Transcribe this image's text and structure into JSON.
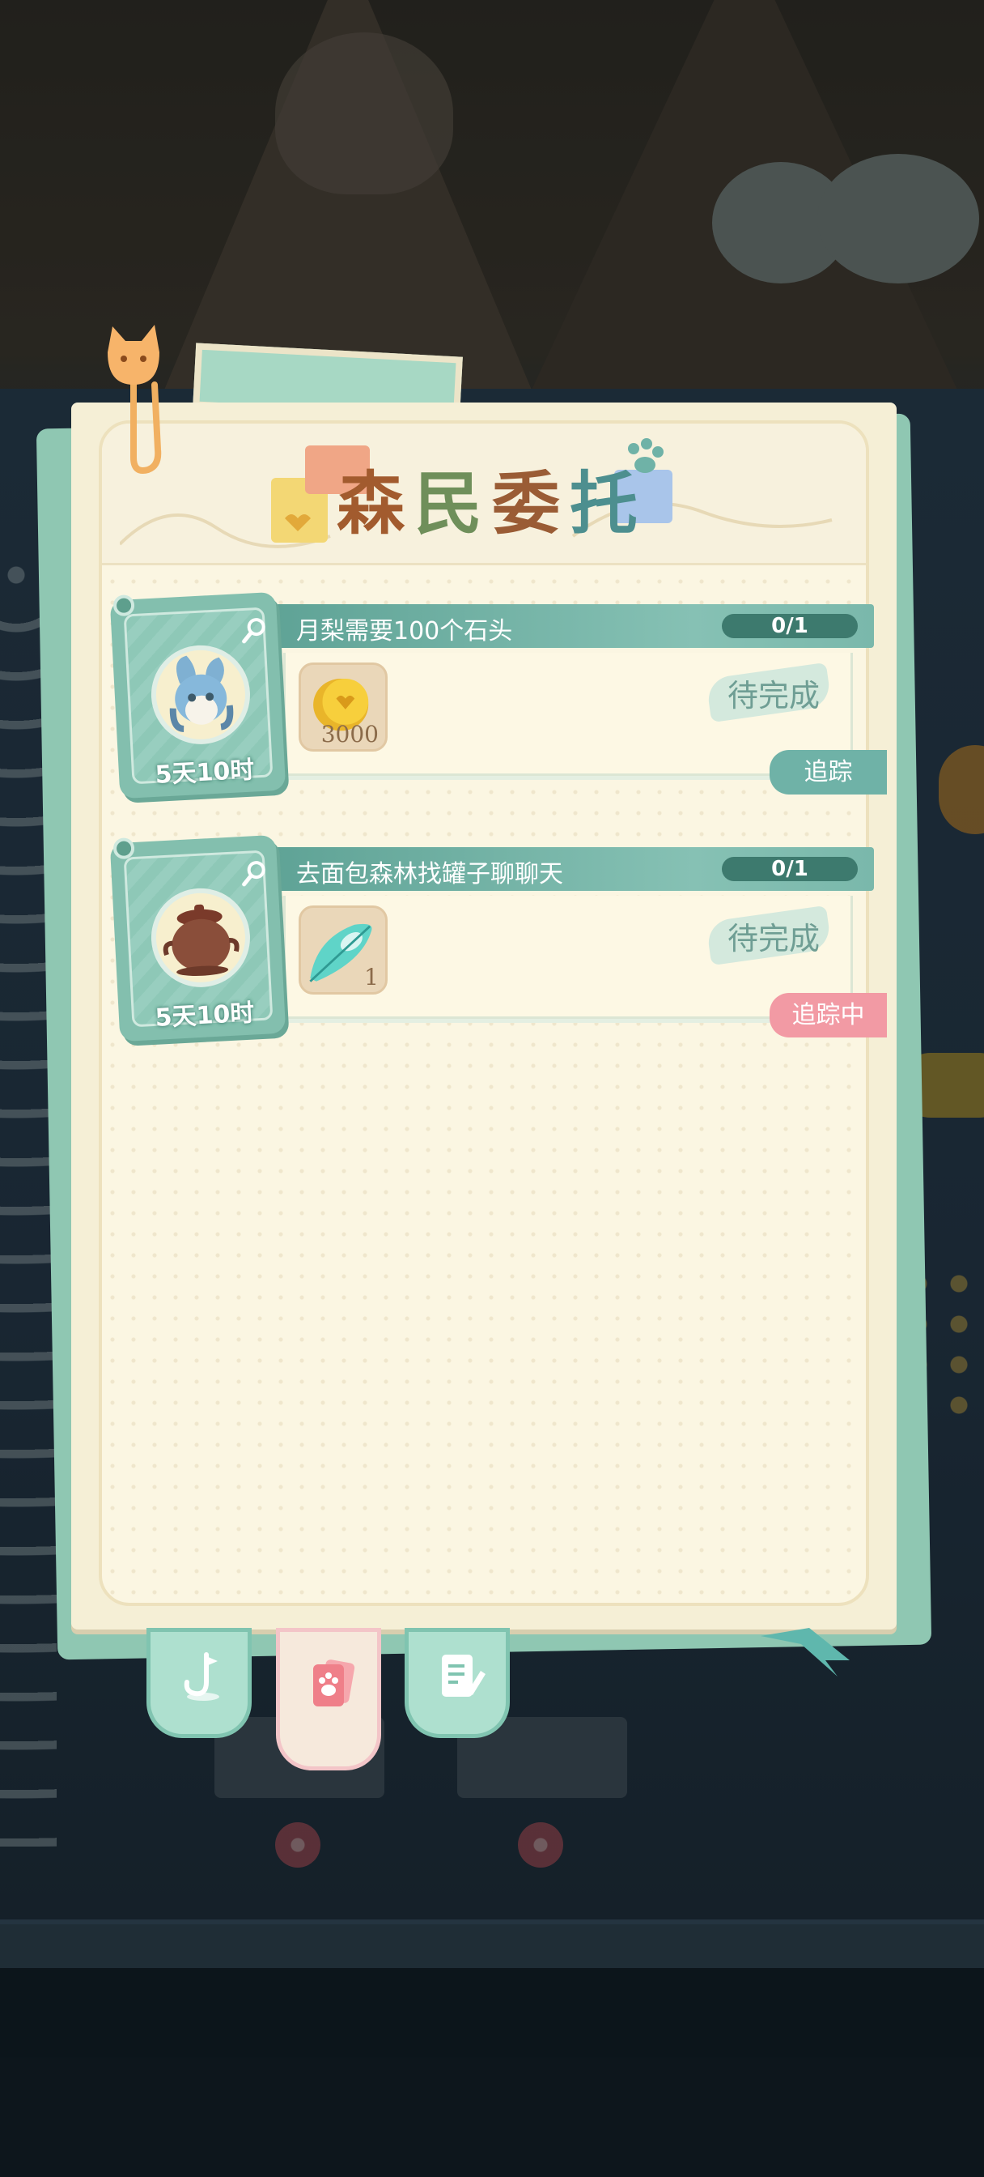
{
  "panel": {
    "title_chars": [
      "森",
      "民",
      "委",
      "托"
    ]
  },
  "quests": [
    {
      "title": "月梨需要100个石头",
      "progress": "0/1",
      "time_left": "5天10时",
      "npc_icon": "blue-rabbit-npc-icon",
      "reward_icon": "gold-coin-icon",
      "reward_count": "3000",
      "status": "待完成",
      "track_label": "追踪",
      "track_state": "track"
    },
    {
      "title": "去面包森林找罐子聊聊天",
      "progress": "0/1",
      "time_left": "5天10时",
      "npc_icon": "clay-pot-npc-icon",
      "reward_icon": "feather-fan-icon",
      "reward_count": "1",
      "status": "待完成",
      "track_label": "追踪中",
      "track_state": "tracking"
    }
  ],
  "tabs": [
    {
      "icon": "fishing-hook-icon"
    },
    {
      "icon": "paw-card-icon",
      "selected": true
    },
    {
      "icon": "notebook-pencil-icon"
    }
  ],
  "colors": {
    "panel": "#f5efd6",
    "accent_teal": "#5fa396",
    "track": "#6fb2a7",
    "tracking": "#f29aa4"
  }
}
